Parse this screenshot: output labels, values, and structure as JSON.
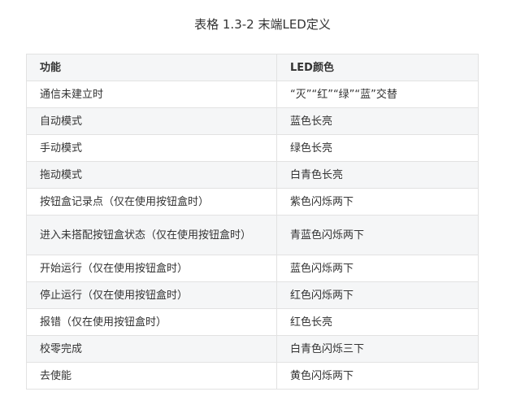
{
  "caption": "表格 1.3-2 末端LED定义",
  "table": {
    "headers": [
      "功能",
      "LED颜色"
    ],
    "rows": [
      [
        "通信未建立时",
        "“灭”“红”“绿”“蓝”交替"
      ],
      [
        "自动模式",
        "蓝色长亮"
      ],
      [
        "手动模式",
        "绿色长亮"
      ],
      [
        "拖动模式",
        "白青色长亮"
      ],
      [
        "按钮盒记录点（仅在使用按钮盒时）",
        "紫色闪烁两下"
      ],
      [
        "进入未搭配按钮盒状态（仅在使用按钮盒时）",
        "青蓝色闪烁两下"
      ],
      [
        "开始运行（仅在使用按钮盒时）",
        "蓝色闪烁两下"
      ],
      [
        "停止运行（仅在使用按钮盒时）",
        "红色闪烁两下"
      ],
      [
        "报错（仅在使用按钮盒时）",
        "红色长亮"
      ],
      [
        "校零完成",
        "白青色闪烁三下"
      ],
      [
        "去使能",
        "黄色闪烁两下"
      ]
    ]
  }
}
